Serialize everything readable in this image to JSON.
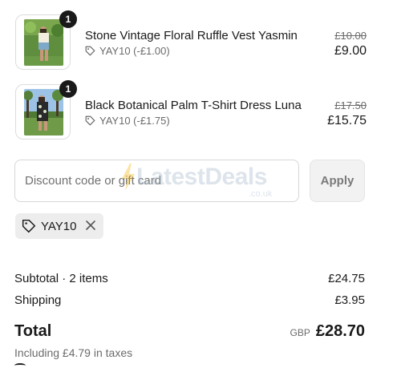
{
  "items": [
    {
      "title": "Stone Vintage Floral Ruffle Vest Yasmin",
      "quantity": "1",
      "discount": "YAY10 (-£1.00)",
      "original_price": "£10.00",
      "price": "£9.00"
    },
    {
      "title": "Black Botanical Palm T-Shirt Dress Luna",
      "quantity": "1",
      "discount": "YAY10 (-£1.75)",
      "original_price": "£17.50",
      "price": "£15.75"
    }
  ],
  "discount": {
    "placeholder": "Discount code or gift card",
    "apply_label": "Apply",
    "applied_code": "YAY10"
  },
  "summary": {
    "subtotal_label": "Subtotal · 2 items",
    "subtotal_value": "£24.75",
    "shipping_label": "Shipping",
    "shipping_value": "£3.95",
    "total_label": "Total",
    "currency": "GBP",
    "total_value": "£28.70",
    "taxes_note": "Including £4.79 in taxes"
  },
  "watermark": {
    "text": "LatestDeals",
    "sub": ".co.uk"
  },
  "colors": {
    "text": "#1a1a1a",
    "muted": "#6b6b6b",
    "chip_bg": "#ededed",
    "button_bg": "#f2f2f2"
  }
}
